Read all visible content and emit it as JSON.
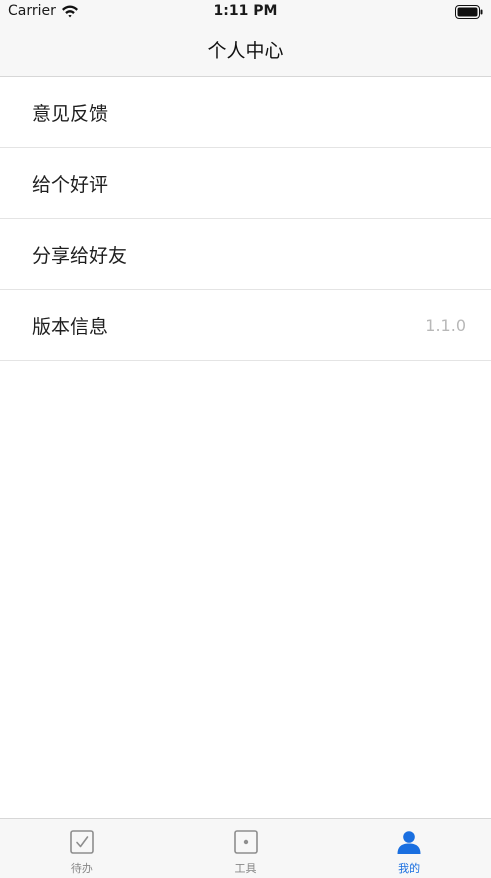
{
  "status_bar": {
    "carrier": "Carrier",
    "time": "1:11 PM"
  },
  "nav": {
    "title": "个人中心"
  },
  "menu": {
    "items": [
      {
        "label": "意见反馈",
        "value": ""
      },
      {
        "label": "给个好评",
        "value": ""
      },
      {
        "label": "分享给好友",
        "value": ""
      },
      {
        "label": "版本信息",
        "value": "1.1.0"
      }
    ]
  },
  "tabs": [
    {
      "label": "待办",
      "icon": "checkbox-icon",
      "active": false
    },
    {
      "label": "工具",
      "icon": "dot-square-icon",
      "active": false
    },
    {
      "label": "我的",
      "icon": "person-icon",
      "active": true
    }
  ],
  "colors": {
    "accent": "#1a6fe0",
    "inactive": "#888888",
    "bar_background": "#f7f7f7"
  }
}
